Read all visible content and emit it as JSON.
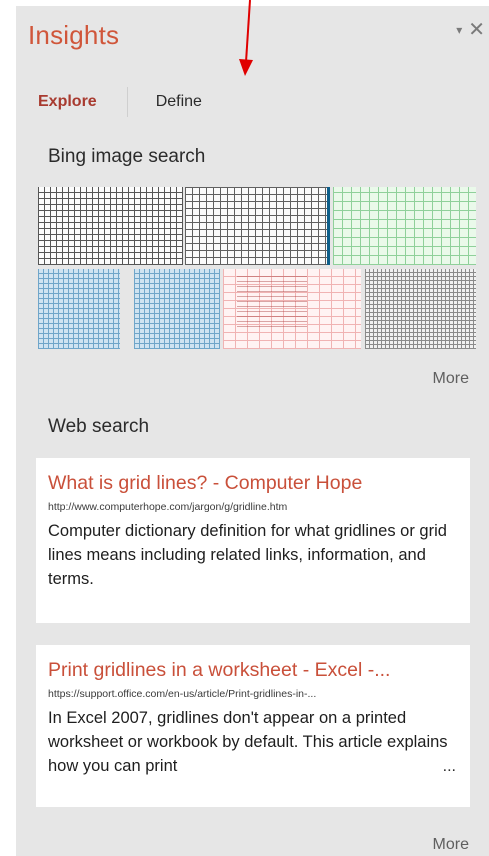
{
  "pane": {
    "title": "Insights",
    "controls": {
      "dropdown_icon": "triangle-down-icon",
      "close_icon": "close-icon",
      "dropdown_glyph": "▾",
      "close_glyph": "✕"
    }
  },
  "tabs": [
    {
      "label": "Explore",
      "active": true
    },
    {
      "label": "Define",
      "active": false
    }
  ],
  "image_search": {
    "heading": "Bing image search",
    "thumbnails": [
      {
        "icon": "black-grid-thumbnail"
      },
      {
        "icon": "black-grid-thumbnail"
      },
      {
        "icon": "green-grid-thumbnail"
      },
      {
        "icon": "blue-grid-thumbnail"
      },
      {
        "icon": "blue-grid-thumbnail"
      },
      {
        "icon": "red-spreadsheet-thumbnail"
      },
      {
        "icon": "gray-grid-thumbnail"
      }
    ],
    "more_label": "More"
  },
  "web_search": {
    "heading": "Web search",
    "results": [
      {
        "title": "What is grid lines? - Computer Hope",
        "url": "http://www.computerhope.com/jargon/g/gridline.htm",
        "snippet": "Computer dictionary definition for what gridlines or grid lines means including related links, information, and terms."
      },
      {
        "title": "Print gridlines in a worksheet - Excel -...",
        "url": "https://support.office.com/en-us/article/Print-gridlines-in-...",
        "snippet": "In Excel 2007, gridlines don't appear on a printed worksheet or workbook by default. This article explains how you can print",
        "ellipsis": "..."
      }
    ],
    "more_label": "More"
  },
  "colors": {
    "title": "#d0563a",
    "active_tab": "#a83a2f",
    "result_title": "#c9503a",
    "pane_background": "#e6e6e6",
    "annotation_arrow": "#e00000"
  }
}
